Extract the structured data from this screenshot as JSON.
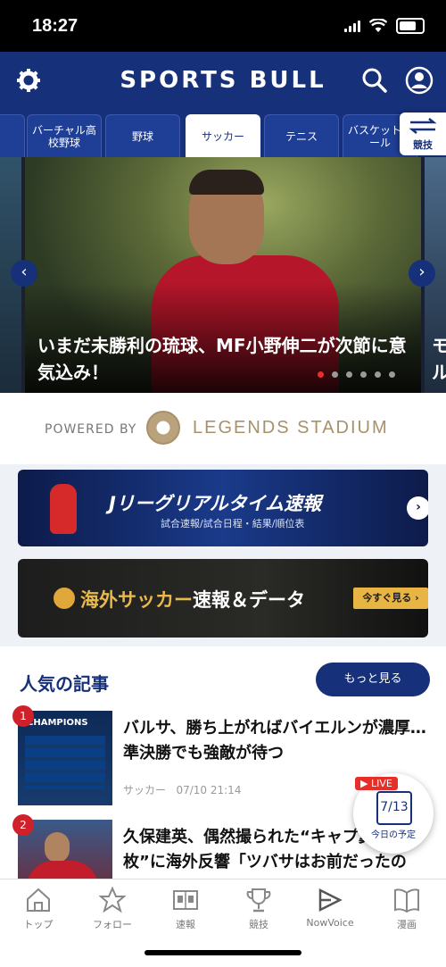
{
  "status_bar": {
    "time": "18:27"
  },
  "header": {
    "title": "SPORTS BULL"
  },
  "tabs": [
    {
      "label": "バーチャル高校野球"
    },
    {
      "label": "野球"
    },
    {
      "label": "サッカー"
    },
    {
      "label": "テニス"
    },
    {
      "label": "バスケットボール"
    }
  ],
  "tab_swap": {
    "label": "競技"
  },
  "hero": {
    "title": "いまだ未勝利の琉球、MF小野伸二が次節に意気込み！",
    "next_peek": "モ\nル",
    "slide_count": 6,
    "active_slide": 1
  },
  "powered": {
    "label": "POWERED BY",
    "brand": "LEGENDS STADIUM"
  },
  "banner_jleague": {
    "title": "Jリーグリアルタイム速報",
    "subtitle": "試合速報/試合日程・結果/順位表"
  },
  "banner_foreign": {
    "title_accent": "海外サッカー",
    "title_rest": "速報＆データ",
    "cta": "今すぐ見る ›"
  },
  "popular": {
    "title": "人気の記事",
    "more_label": "もっと見る",
    "articles": [
      {
        "rank": "1",
        "headline": "バルサ、勝ち上がればバイエルンが濃厚…準決勝でも強敵が待つ",
        "category": "サッカー",
        "date": "07/10 21:14"
      },
      {
        "rank": "2",
        "headline": "久保建英、偶然撮られた“キャプ翼風の1枚”に海外反響「ツバサはお前だったの",
        "category": "",
        "date": ""
      }
    ]
  },
  "live_widget": {
    "badge": "LIVE",
    "date": "7/13",
    "label": "今日の予定"
  },
  "bottom_nav": [
    {
      "label": "トップ"
    },
    {
      "label": "フォロー"
    },
    {
      "label": "速報"
    },
    {
      "label": "競技"
    },
    {
      "label": "NowVoice"
    },
    {
      "label": "漫画"
    }
  ],
  "colors": {
    "brand_navy": "#16307a",
    "accent_red": "#e5302a",
    "gold": "#e8b443"
  }
}
